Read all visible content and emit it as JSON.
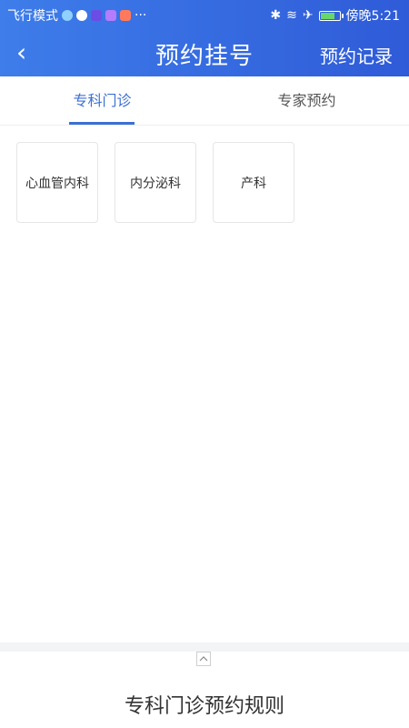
{
  "status_bar": {
    "left_text": "飞行模式",
    "more": "···",
    "right_text": "傍晚5:21",
    "icons": [
      "weather-icon",
      "q-app-icon",
      "video-app-icon",
      "app-icon",
      "weibo-icon",
      "bluetooth-icon",
      "wifi-icon",
      "airplane-icon",
      "battery-icon"
    ],
    "colors": {
      "battery_fill": "#69d66a"
    }
  },
  "header": {
    "title": "预约挂号",
    "right_action": "预约记录",
    "back_icon": "chevron-left-icon",
    "gradient_start": "#3e7dea",
    "gradient_end": "#2f5bd8"
  },
  "tabs": [
    {
      "label": "专科门诊",
      "active": true
    },
    {
      "label": "专家预约",
      "active": false
    }
  ],
  "departments": [
    {
      "label": "心血管内科"
    },
    {
      "label": "内分泌科"
    },
    {
      "label": "产科"
    }
  ],
  "rules": {
    "title": "专科门诊预约规则",
    "toggle_icon": "chevron-up-icon"
  }
}
